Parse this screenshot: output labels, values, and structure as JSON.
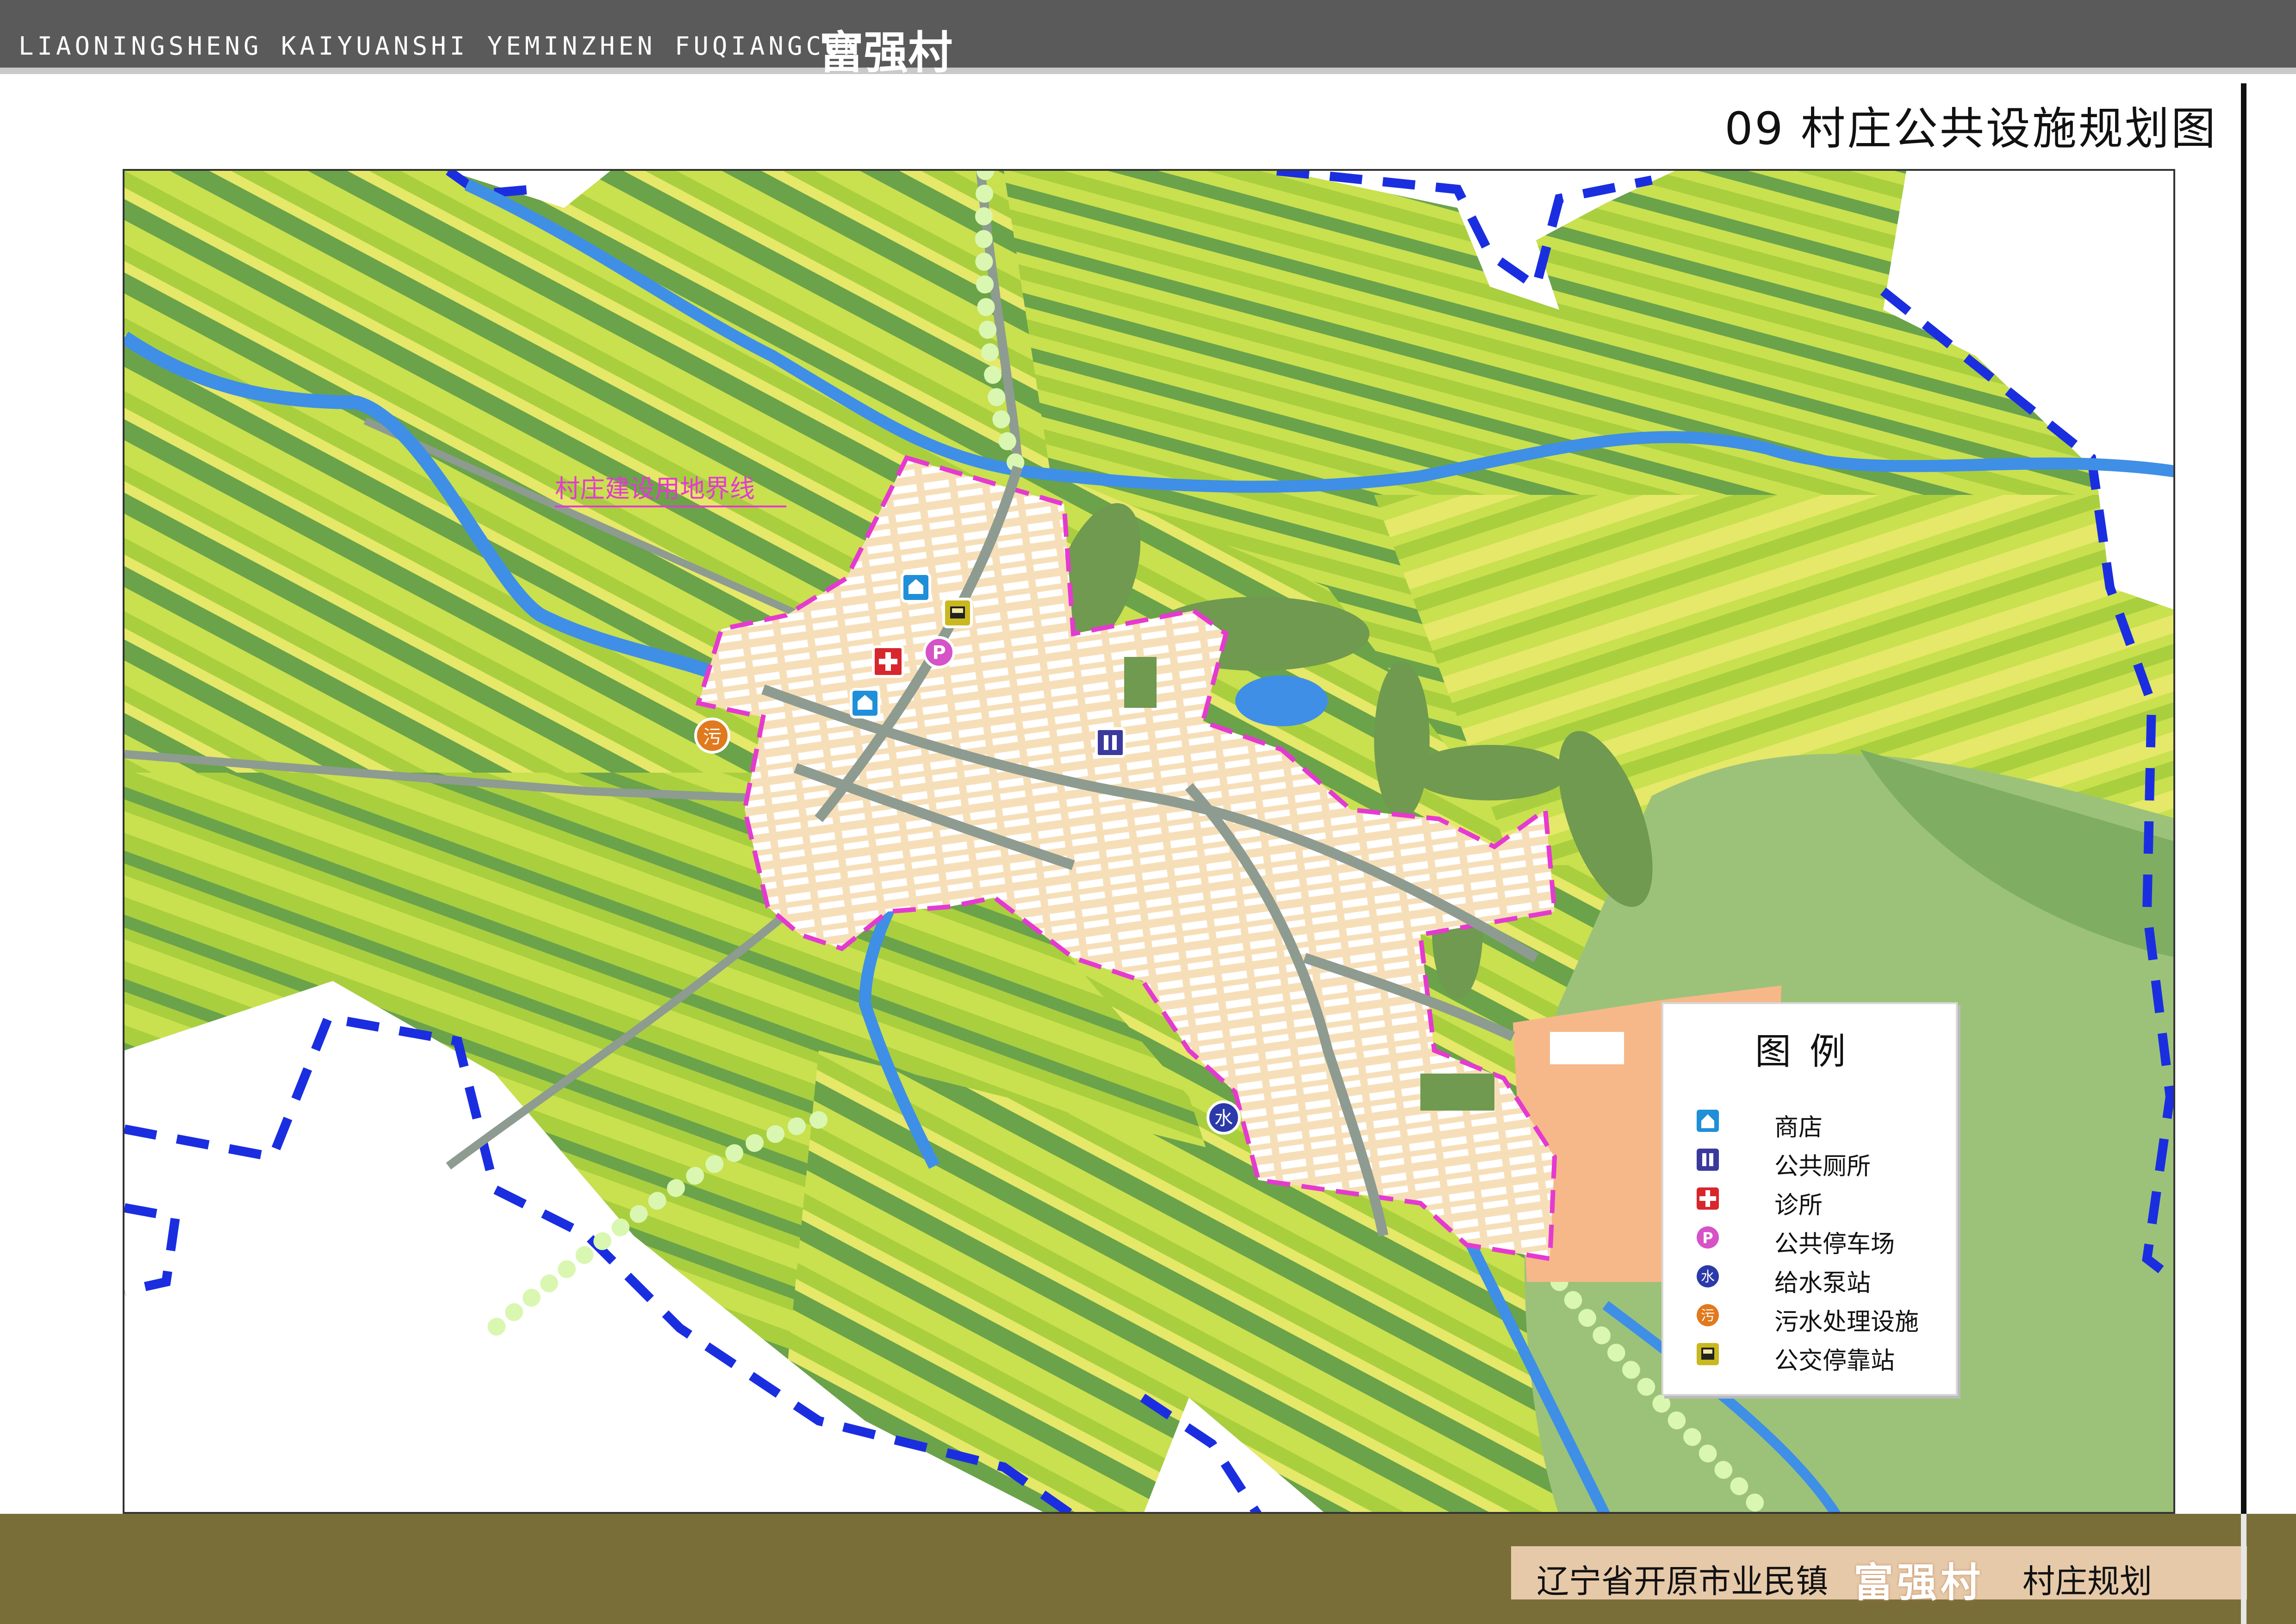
{
  "header": {
    "title_en": "LIAONINGSHENG KAIYUANSHI YEMINZHEN FUQIANGCUN",
    "title_cn": "富强村"
  },
  "sheet": {
    "title": "09 村庄公共设施规划图"
  },
  "map": {
    "boundary_label": "村庄建设用地界线",
    "colors": {
      "field_light": "#c9e04f",
      "field_mid": "#a9cf3f",
      "field_dark": "#6aa34a",
      "field_yellow": "#e5e868",
      "woodland": "#6f9a4f",
      "hill": "#9cc27a",
      "residential": "#f6dfb8",
      "industrial": "#f7b889",
      "road": "#8e9b90",
      "water": "#3f8fe6",
      "construction_boundary": "#e53ad0",
      "admin_boundary": "#1a2ee0",
      "greenway": "#d9f7b0"
    }
  },
  "legend": {
    "title": "图例",
    "items": [
      {
        "label": "商店",
        "icon": "shop-icon",
        "color": "#1f8fd8"
      },
      {
        "label": "公共厕所",
        "icon": "toilet-icon",
        "color": "#3b3a9c"
      },
      {
        "label": "诊所",
        "icon": "clinic-icon",
        "color": "#d8262d"
      },
      {
        "label": "公共停车场",
        "icon": "parking-icon",
        "color": "#d553c6"
      },
      {
        "label": "给水泵站",
        "icon": "water-pump-icon",
        "color": "#2b3aa8"
      },
      {
        "label": "污水处理设施",
        "icon": "sewage-icon",
        "color": "#e07a1d"
      },
      {
        "label": "公交停靠站",
        "icon": "bus-stop-icon",
        "color": "#c9b81f"
      }
    ]
  },
  "facility_glyphs": {
    "water": "水",
    "sewage": "污",
    "parking": "P"
  },
  "footer": {
    "prefix": "辽宁省开原市业民镇",
    "village": "富强村",
    "suffix": "村庄规划"
  }
}
